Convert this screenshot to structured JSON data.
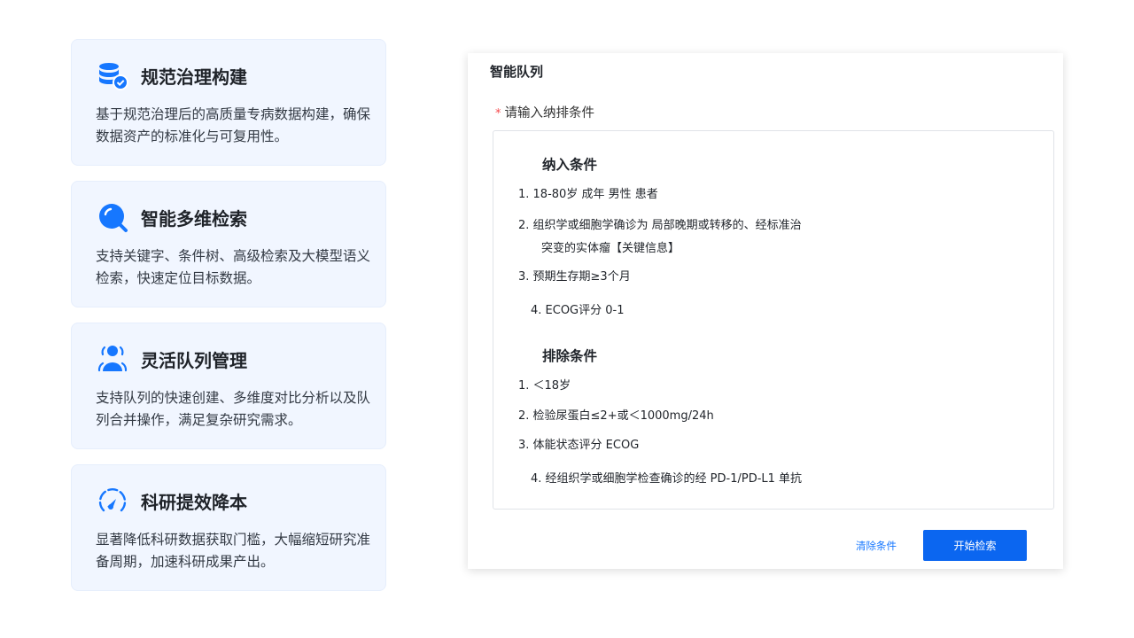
{
  "cards": [
    {
      "title": "规范治理构建",
      "desc": "基于规范治理后的高质量专病数据构建，确保数据资产的标准化与可复用性。",
      "icon": "database-check-icon"
    },
    {
      "title": "智能多维检索",
      "desc": "支持关键字、条件树、高级检索及大模型语义检索，快速定位目标数据。",
      "icon": "search-icon"
    },
    {
      "title": "灵活队列管理",
      "desc": "支持队列的快速创建、多维度对比分析以及队列合并操作，满足复杂研究需求。",
      "icon": "user-group-icon"
    },
    {
      "title": "科研提效降本",
      "desc": "显著降低科研数据获取门槛，大幅缩短研究准备周期，加速科研成果产出。",
      "icon": "speedometer-icon"
    }
  ],
  "panel": {
    "title": "智能队列",
    "field_required": "*",
    "field_label": "请输入纳排条件",
    "inclusion": {
      "title": "纳入条件",
      "items": [
        "1. 18-80岁 成年  男性  患者",
        "2. 组织学或细胞学确诊为 局部晚期或转移的、经标准治",
        "突变的实体瘤【关键信息】",
        "3. 预期生存期≥3个月",
        "4. ECOG评分 0-1"
      ]
    },
    "exclusion": {
      "title": "排除条件",
      "items": [
        "1.  ＜18岁",
        "2. 检验尿蛋白≤2+或＜1000mg/24h",
        "3. 体能状态评分 ECOG",
        "4. 经组织学或细胞学检查确诊的经 PD-1/PD-L1 单抗"
      ]
    },
    "clear_label": "清除条件",
    "search_label": "开始检索"
  },
  "colors": {
    "accent": "#0b66f0",
    "card_bg": "#f1f6ff",
    "icon_blue": "#1677ff",
    "required": "#f5484b"
  }
}
